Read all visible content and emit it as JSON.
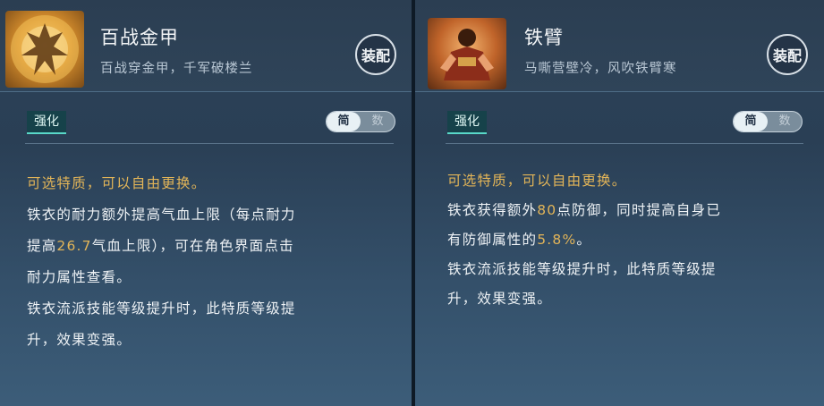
{
  "left": {
    "title": "百战金甲",
    "subtitle": "百战穿金甲，千军破楼兰",
    "equip_label": "装配",
    "tag_label": "强化",
    "toggle": {
      "on": "简",
      "off": "数"
    },
    "lines": {
      "l1": "可选特质，可以自由更换。",
      "l2": "铁衣的耐力额外提高气血上限（每点耐力",
      "l3_a": "提高",
      "l3_num": "26.7",
      "l3_b": "气血上限），可在角色界面点击",
      "l4": "耐力属性查看。",
      "l5": "铁衣流派技能等级提升时，此特质等级提",
      "l6": "升，效果变强。"
    }
  },
  "right": {
    "title": "铁臂",
    "subtitle": "马嘶营壁冷，风吹铁臂寒",
    "equip_label": "装配",
    "tag_label": "强化",
    "toggle": {
      "on": "简",
      "off": "数"
    },
    "lines": {
      "l1": "可选特质，可以自由更换。",
      "l2_a": "铁衣获得额外",
      "l2_num": "80",
      "l2_b": "点防御，同时提高自身已",
      "l3_a": "有防御属性的",
      "l3_num": "5.8%",
      "l3_b": "。",
      "l4": "铁衣流派技能等级提升时，此特质等级提",
      "l5": "升，效果变强。"
    }
  },
  "colors": {
    "highlight": "#e3b558",
    "accent": "#59d8c9",
    "text": "#eef2f5"
  }
}
